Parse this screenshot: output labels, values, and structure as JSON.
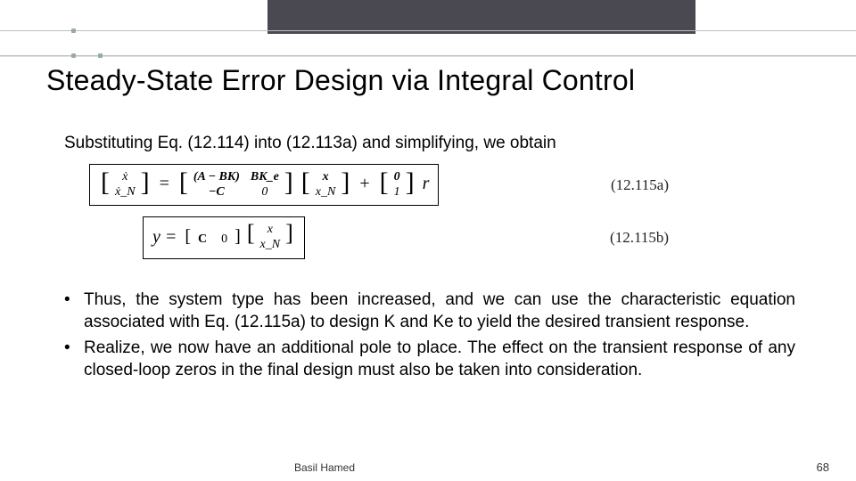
{
  "header": {
    "title": "Steady-State Error Design via Integral Control"
  },
  "subline": "Substituting Eq. (12.114) into (12.113a) and simplifying, we obtain",
  "equations": {
    "eq_a": {
      "lhs_top": "ẋ",
      "lhs_bot": "ẋ_N",
      "block_11": "(A − BK)",
      "block_12": "BK_e",
      "block_21": "−C",
      "block_22": "0",
      "vec_top": "x",
      "vec_bot": "x_N",
      "add_top": "0",
      "add_bot": "1",
      "tail": "r",
      "label": "(12.115a)"
    },
    "eq_b": {
      "lhs": "y =",
      "row_1": "C",
      "row_2": "0",
      "vec_top": "x",
      "vec_bot": "x_N",
      "label": "(12.115b)"
    }
  },
  "bullets": [
    "Thus, the system type has been increased, and we can use the characteristic equation associated with Eq. (12.115a) to design K and Ke to yield the desired transient response.",
    "Realize, we now have an additional pole to place. The effect on the transient response of any closed-loop zeros in the final design must also be taken into consideration."
  ],
  "footer": {
    "author": "Basil Hamed",
    "page": "68"
  }
}
